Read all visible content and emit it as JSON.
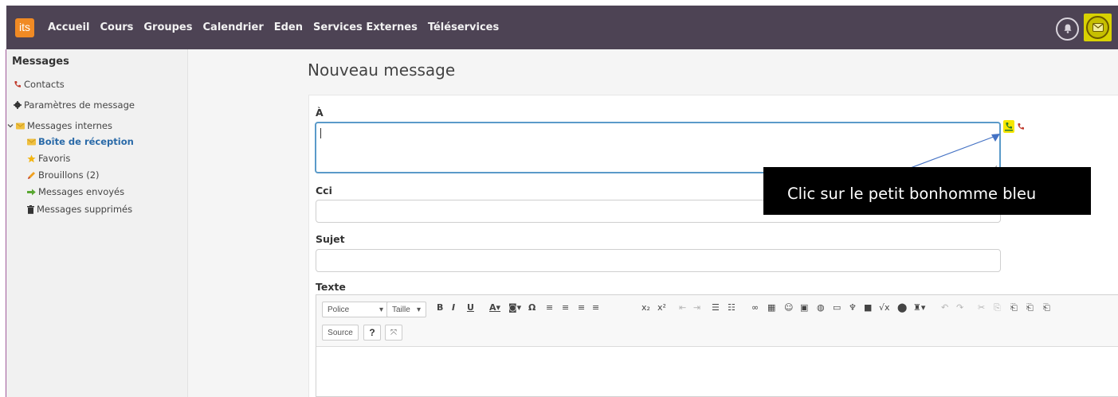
{
  "nav": {
    "logo": "its",
    "items": [
      "Accueil",
      "Cours",
      "Groupes",
      "Calendrier",
      "Eden",
      "Services Externes",
      "Téléservices"
    ]
  },
  "sidebar": {
    "title": "Messages",
    "contacts": "Contacts",
    "settings": "Paramètres de message",
    "internal": "Messages internes",
    "inbox": "Boîte de réception",
    "favorites": "Favoris",
    "drafts": "Brouillons (2)",
    "sent": "Messages envoyés",
    "deleted": "Messages supprimés"
  },
  "page": {
    "title": "Nouveau message"
  },
  "form": {
    "to_label": "À",
    "cc_label": "Cci",
    "subject_label": "Sujet",
    "text_label": "Texte"
  },
  "callout": "Clic sur le petit bonhomme bleu",
  "editor": {
    "font_label": "Police",
    "size_label": "Taille",
    "source_label": "Source",
    "help_label": "?"
  },
  "colors": {
    "topbar": "#4d4354",
    "accent_blue": "#2a6aa8",
    "highlight": "#f5e600",
    "logo_orange": "#f08a24"
  }
}
